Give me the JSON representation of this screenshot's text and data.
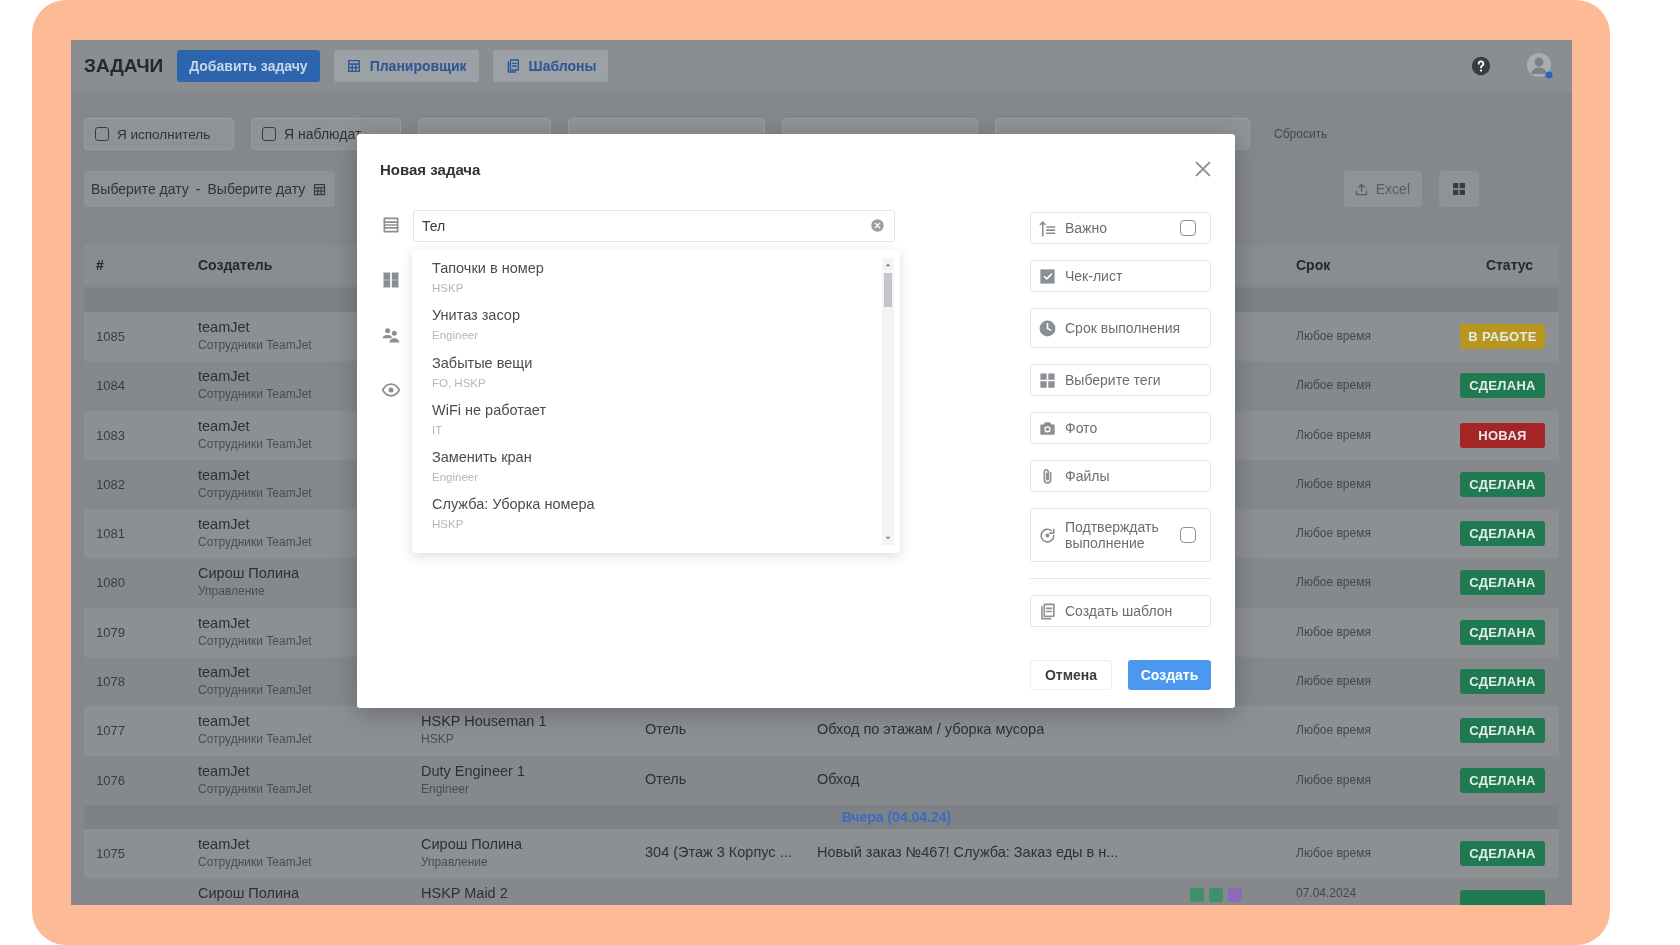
{
  "app": {
    "title": "ЗАДАЧИ",
    "actions": [
      {
        "label": "Добавить задачу",
        "kind": "primary"
      },
      {
        "label": "Планировщик",
        "kind": "calendar"
      },
      {
        "label": "Шаблоны",
        "kind": "templates"
      }
    ]
  },
  "filters": [
    {
      "kind": "checkbox",
      "label": "Я исполнитель",
      "checked": false
    },
    {
      "kind": "checkbox",
      "label": "Я наблюдат",
      "checked": false
    },
    {
      "kind": "checkbox"
    },
    {
      "kind": "tags"
    },
    {
      "kind": "objects"
    },
    {
      "kind": "search"
    }
  ],
  "reset": "Сбросить",
  "date_range": {
    "from": "Выберите дату",
    "separator": "-",
    "to": "Выберите дату"
  },
  "export": "Excel",
  "table": {
    "header": {
      "number": "#",
      "creator": "Создатель",
      "deadline": "Срок",
      "status": "Статус"
    },
    "groups": [
      {
        "rows": [
          {
            "id": "1085",
            "creator": "teamJet",
            "creator_team": "Сотрудники TeamJet",
            "deadline": "Любое время",
            "status": "В РАБОТЕ",
            "color": "#b8961f"
          },
          {
            "id": "1084",
            "creator": "teamJet",
            "creator_team": "Сотрудники TeamJet",
            "deadline": "Любое время",
            "status": "СДЕЛАНА",
            "color": "#1f7a52"
          },
          {
            "id": "1083",
            "creator": "teamJet",
            "creator_team": "Сотрудники TeamJet",
            "deadline": "Любое время",
            "status": "НОВАЯ",
            "color": "#a32525"
          },
          {
            "id": "1082",
            "creator": "teamJet",
            "creator_team": "Сотрудники TeamJet",
            "deadline": "Любое время",
            "status": "СДЕЛАНА",
            "color": "#1f7a52"
          },
          {
            "id": "1081",
            "creator": "teamJet",
            "creator_team": "Сотрудники TeamJet",
            "deadline": "Любое время",
            "status": "СДЕЛАНА",
            "color": "#1f7a52"
          },
          {
            "id": "1080",
            "creator": "Сирош Полина",
            "creator_team": "Управление",
            "deadline": "Любое время",
            "status": "СДЕЛАНА",
            "color": "#1f7a52"
          },
          {
            "id": "1079",
            "creator": "teamJet",
            "creator_team": "Сотрудники TeamJet",
            "deadline": "Любое время",
            "status": "СДЕЛАНА",
            "color": "#1f7a52"
          },
          {
            "id": "1078",
            "creator": "teamJet",
            "creator_team": "Сотрудники TeamJet",
            "deadline": "Любое время",
            "status": "СДЕЛАНА",
            "color": "#1f7a52"
          },
          {
            "id": "1077",
            "creator": "teamJet",
            "creator_team": "Сотрудники TeamJet",
            "executor": "HSKP Houseman 1",
            "executor_team": "HSKP",
            "place": "Отель",
            "task": "Обход по этажам / уборка мусора",
            "deadline": "Любое время",
            "status": "СДЕЛАНА",
            "color": "#1f7a52"
          },
          {
            "id": "1076",
            "creator": "teamJet",
            "creator_team": "Сотрудники TeamJet",
            "executor": "Duty Engineer 1",
            "executor_team": "Engineer",
            "place": "Отель",
            "task": "Обход",
            "deadline": "Любое время",
            "status": "СДЕЛАНА",
            "color": "#1f7a52"
          }
        ]
      },
      {
        "label": "Вчера (04.04.24)",
        "rows": [
          {
            "id": "1075",
            "creator": "teamJet",
            "creator_team": "Сотрудники TeamJet",
            "executor": "Сирош Полина",
            "executor_team": "Управление",
            "place": "304 (Этаж 3 Корпус ...",
            "task": "Новый заказ №467! Служба: Заказ еды в н...",
            "deadline": "Любое время",
            "status": "СДЕЛАНА",
            "color": "#1f7a52"
          },
          {
            "creator": "Сирош Полина",
            "executor": "HSKP Maid 2",
            "tags": [
              {
                "color": "#3f8f68"
              },
              {
                "color": "#3f8f68"
              },
              {
                "color": "#8a6bb8"
              }
            ],
            "deadline": "07.04.2024",
            "color": "#1f7a52"
          }
        ]
      }
    ]
  },
  "modal": {
    "title": "Новая задача",
    "task_field": {
      "value": "Тел"
    },
    "suggestions": [
      {
        "title": "Тапочки в номер",
        "team": "HSKP"
      },
      {
        "title": "Унитаз засор",
        "team": "Engineer"
      },
      {
        "title": "Забытые вещи",
        "team": "FO, HSKP"
      },
      {
        "title": "WiFi не работает",
        "team": "IT"
      },
      {
        "title": "Заменить кран",
        "team": "Engineer"
      },
      {
        "title": "Служба: Уборка номера",
        "team": "HSKP"
      }
    ],
    "options": [
      {
        "kind": "important",
        "label": "Важно",
        "checked": false
      },
      {
        "kind": "checklist",
        "label": "Чек-лист"
      },
      {
        "kind": "deadline",
        "label": "Срок выполнения"
      },
      {
        "kind": "tags",
        "label": "Выберите теги"
      },
      {
        "kind": "photo",
        "label": "Фото"
      },
      {
        "kind": "files",
        "label": "Файлы"
      },
      {
        "kind": "confirm",
        "label": "Подтверждать выполнение",
        "checked": false
      }
    ],
    "template_button": "Создать шаблон",
    "buttons": [
      {
        "label": "Отмена",
        "kind": "secondary"
      },
      {
        "label": "Создать",
        "kind": "primary"
      }
    ]
  }
}
